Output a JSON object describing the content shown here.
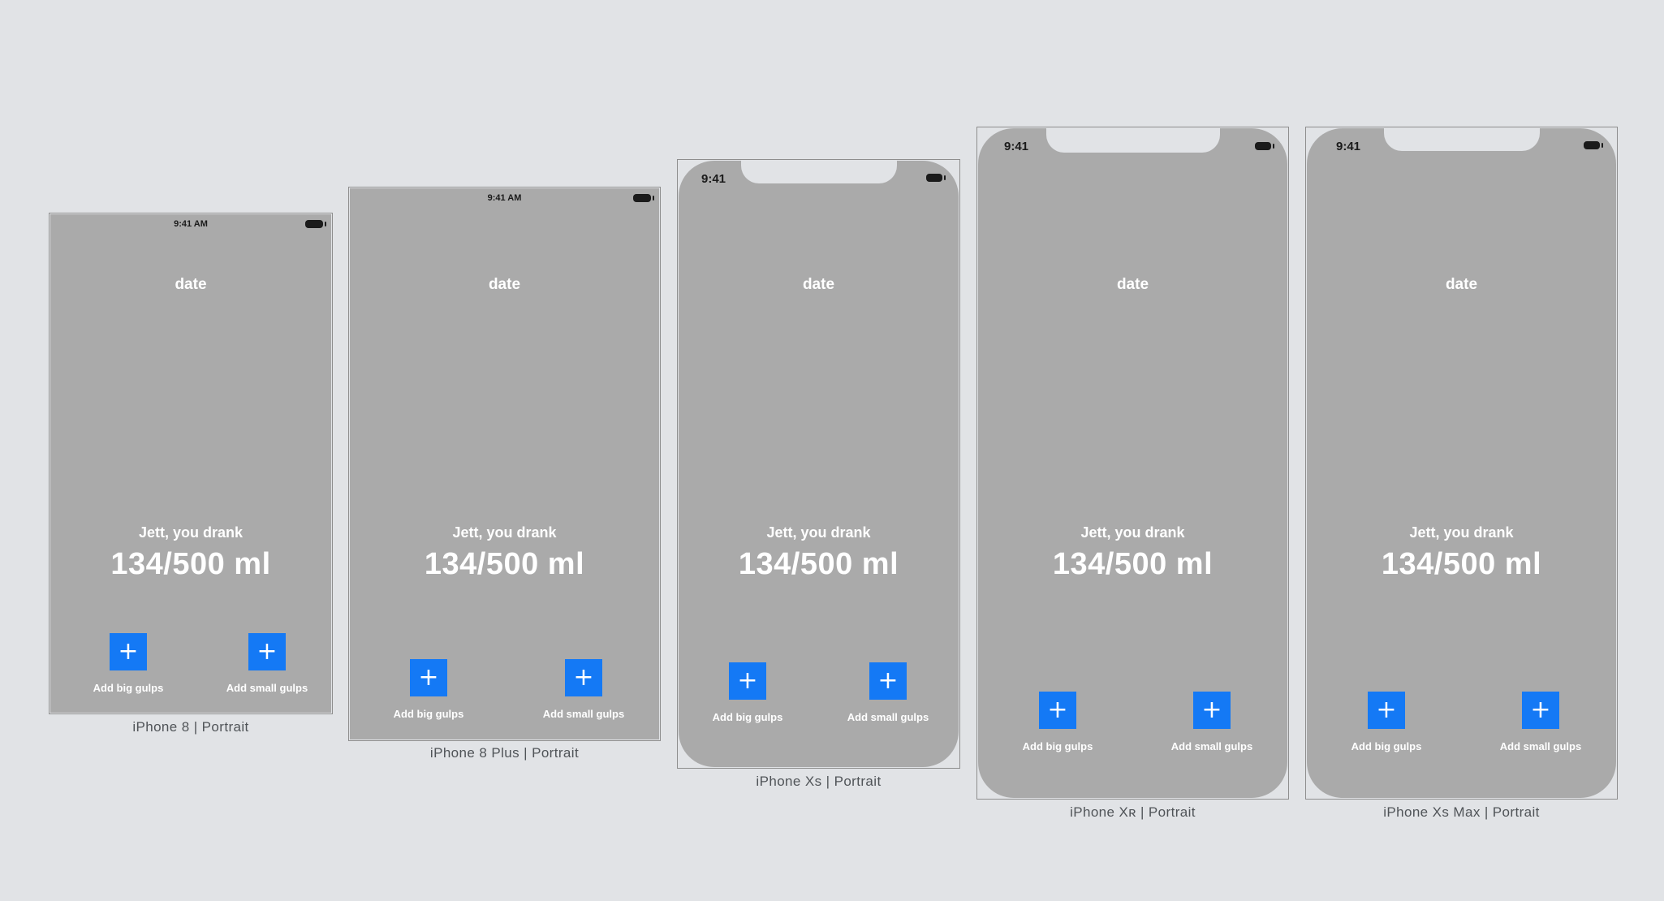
{
  "devices": [
    {
      "caption": "iPhone 8 | Portrait",
      "status_time": "9:41 AM",
      "date_label": "date",
      "drank_label": "Jett, you drank",
      "amount": "134/500 ml",
      "big_button_icon": "+",
      "big_button_label": "Add big gulps",
      "small_button_icon": "+",
      "small_button_label": "Add small gulps"
    },
    {
      "caption": "iPhone 8 Plus | Portrait",
      "status_time": "9:41 AM",
      "date_label": "date",
      "drank_label": "Jett, you drank",
      "amount": "134/500 ml",
      "big_button_icon": "+",
      "big_button_label": "Add big gulps",
      "small_button_icon": "+",
      "small_button_label": "Add small gulps"
    },
    {
      "caption": "iPhone Xs | Portrait",
      "status_time": "9:41",
      "date_label": "date",
      "drank_label": "Jett, you drank",
      "amount": "134/500 ml",
      "big_button_icon": "+",
      "big_button_label": "Add big gulps",
      "small_button_icon": "+",
      "small_button_label": "Add small gulps"
    },
    {
      "caption": "iPhone Xʀ | Portrait",
      "status_time": "9:41",
      "date_label": "date",
      "drank_label": "Jett, you drank",
      "amount": "134/500 ml",
      "big_button_icon": "+",
      "big_button_label": "Add big gulps",
      "small_button_icon": "+",
      "small_button_label": "Add small gulps"
    },
    {
      "caption": "iPhone Xs Max | Portrait",
      "status_time": "9:41",
      "date_label": "date",
      "drank_label": "Jett, you drank",
      "amount": "134/500 ml",
      "big_button_icon": "+",
      "big_button_label": "Add big gulps",
      "small_button_icon": "+",
      "small_button_label": "Add small gulps"
    }
  ],
  "colors": {
    "canvas_background": "#e1e3e6",
    "screen_background": "#aaaaaa",
    "button_accent": "#1479f5",
    "text_on_screen": "#ffffff",
    "status_text": "#1b1b1b"
  },
  "icons": {
    "add_button": "plus-icon",
    "battery": "battery-icon"
  }
}
